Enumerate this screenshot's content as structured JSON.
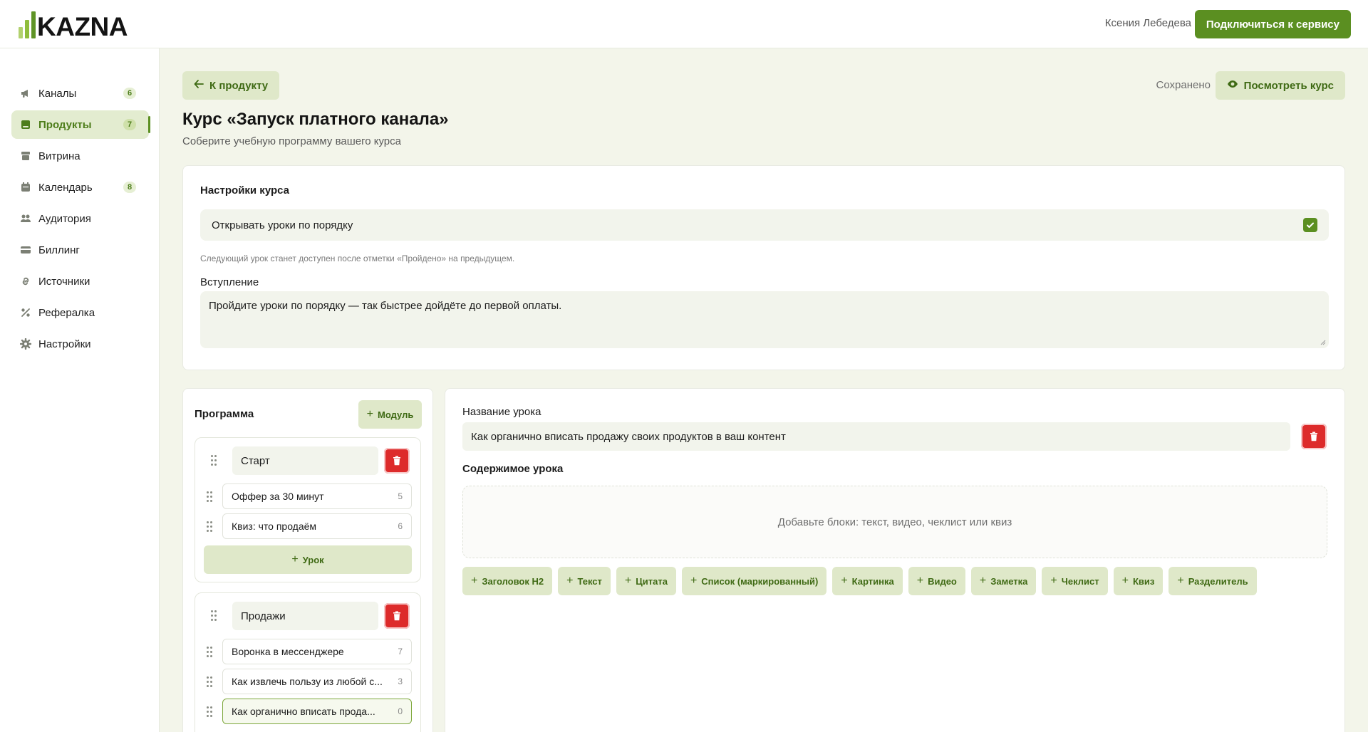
{
  "header": {
    "logo_text": "KAZNA",
    "user_name": "Ксения Лебедева",
    "connect_label": "Подключиться к сервису"
  },
  "sidebar": {
    "items": [
      {
        "label": "Каналы",
        "icon": "megaphone-icon",
        "badge": "6"
      },
      {
        "label": "Продукты",
        "icon": "book-icon",
        "badge": "7",
        "active": true
      },
      {
        "label": "Витрина",
        "icon": "storefront-icon"
      },
      {
        "label": "Календарь",
        "icon": "calendar-icon",
        "badge": "8"
      },
      {
        "label": "Аудитория",
        "icon": "users-icon"
      },
      {
        "label": "Биллинг",
        "icon": "credit-card-icon"
      },
      {
        "label": "Источники",
        "icon": "link-icon"
      },
      {
        "label": "Рефералка",
        "icon": "percent-icon"
      },
      {
        "label": "Настройки",
        "icon": "gear-icon"
      }
    ]
  },
  "top": {
    "back_label": "К продукту",
    "saved_label": "Сохранено",
    "view_label": "Посмотреть курс"
  },
  "page": {
    "title": "Курс «Запуск платного канала»",
    "subtitle": "Соберите учебную программу вашего курса"
  },
  "settings": {
    "heading": "Настройки курса",
    "sequential_label": "Открывать уроки по порядку",
    "sequential_checked": true,
    "hint": "Следующий урок станет доступен после отметки «Пройдено» на предыдущем.",
    "intro_label": "Вступление",
    "intro_value": "Пройдите уроки по порядку — так быстрее дойдёте до первой оплаты."
  },
  "program": {
    "heading": "Программа",
    "add_module_label": "Модуль",
    "add_lesson_label": "Урок",
    "modules": [
      {
        "name": "Старт",
        "lessons": [
          {
            "title": "Оффер за 30 минут",
            "count": "5"
          },
          {
            "title": "Квиз: что продаём",
            "count": "6"
          }
        ]
      },
      {
        "name": "Продажи",
        "lessons": [
          {
            "title": "Воронка в мессенджере",
            "count": "7"
          },
          {
            "title": "Как извлечь пользу из любой с...",
            "count": "3"
          },
          {
            "title": "Как органично вписать прода...",
            "count": "0",
            "active": true
          }
        ]
      }
    ]
  },
  "editor": {
    "title_label": "Название урока",
    "title_value": "Как органично вписать продажу своих продуктов в ваш контент",
    "content_label": "Содержимое урока",
    "dropzone_text": "Добавьте блоки: текст, видео, чеклист или квиз",
    "blocks": [
      "Заголовок H2",
      "Текст",
      "Цитата",
      "Список (маркированный)",
      "Картинка",
      "Видео",
      "Заметка",
      "Чеклист",
      "Квиз",
      "Разделитель"
    ]
  },
  "colors": {
    "accent": "#5b8f21",
    "accent_soft": "#dfe8c9",
    "danger": "#dd2b2b",
    "background": "#f3f5ea"
  }
}
